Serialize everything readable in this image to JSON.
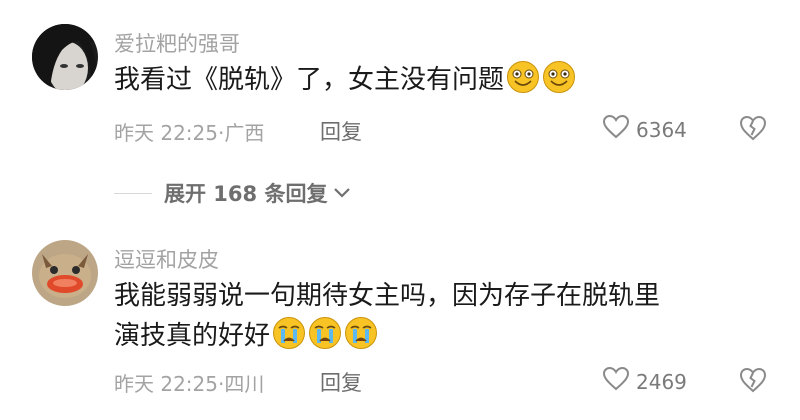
{
  "comments": [
    {
      "username": "爱拉粑的强哥",
      "text": "我看过《脱轨》了，女主没有问题",
      "emoji_icons": [
        "laughing-emoji-icon",
        "laughing-emoji-icon"
      ],
      "time_location": "昨天 22:25·广西",
      "reply_label": "回复",
      "likes": "6364"
    },
    {
      "username": "逗逗和皮皮",
      "text": "我能弱弱说一句期待女主吗，因为存子在脱轨里演技真的好好",
      "emoji_icons": [
        "crying-emoji-icon",
        "crying-emoji-icon",
        "crying-emoji-icon"
      ],
      "time_location": "昨天 22:25·四川",
      "reply_label": "回复",
      "likes": "2469"
    }
  ],
  "expand": {
    "label": "展开 168 条回复",
    "icon": "chevron-down-icon"
  },
  "colors": {
    "secondary_text": "#a3a3a3",
    "primary_text": "#1a1a1a",
    "emoji_yellow": "#f7c325"
  }
}
